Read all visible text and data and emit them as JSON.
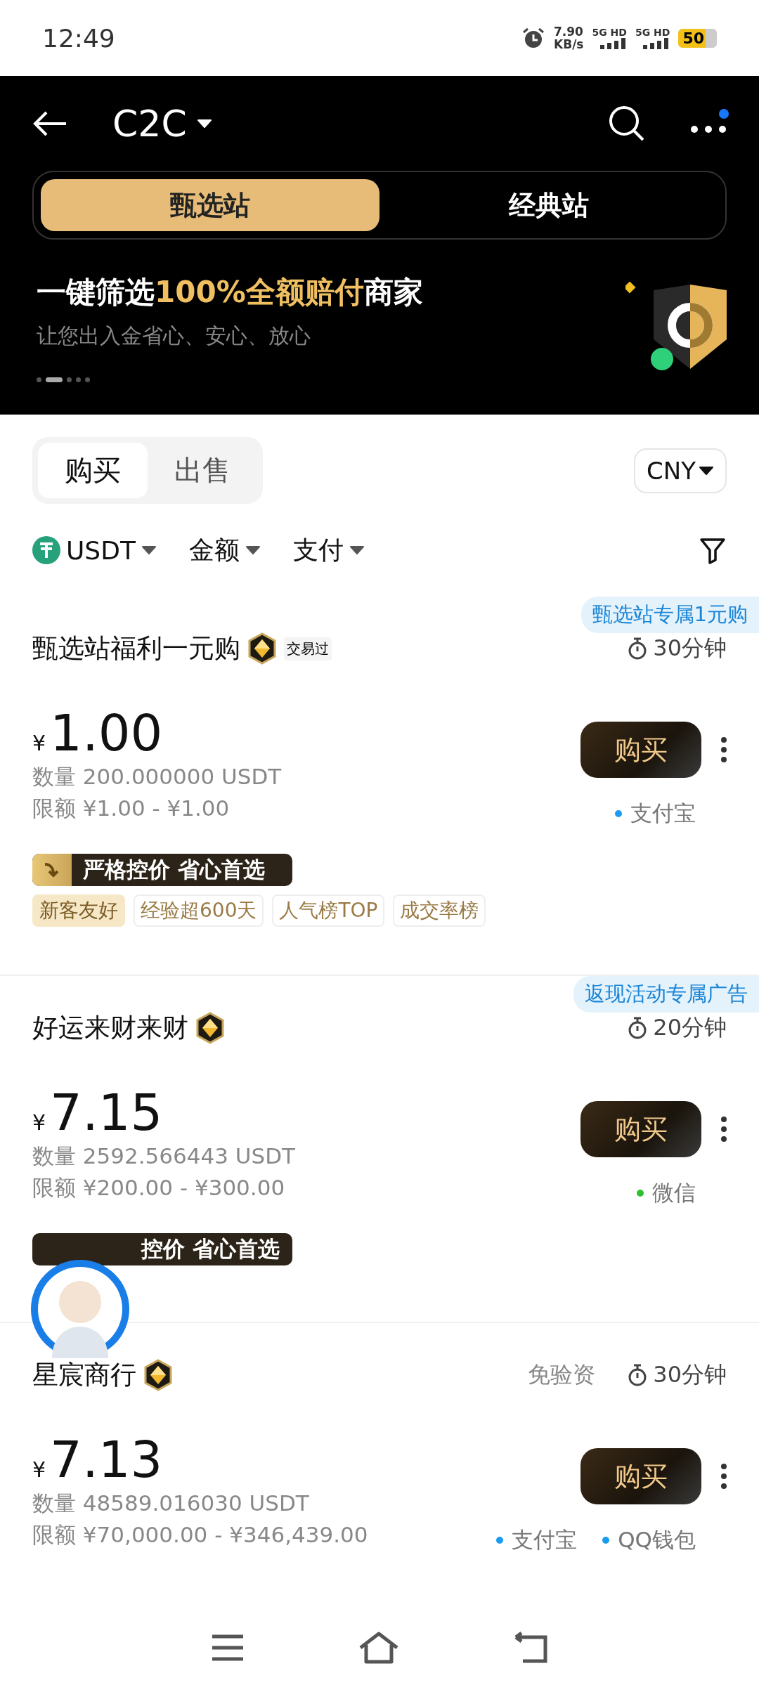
{
  "status_bar": {
    "time": "12:49",
    "speed": "7.90",
    "speed_unit": "KB/s",
    "networks": [
      "5G HD",
      "5G HD"
    ],
    "battery": "50"
  },
  "header": {
    "title": "C2C",
    "has_notification": true
  },
  "stations": [
    {
      "label": "甄选站",
      "selected": true
    },
    {
      "label": "经典站",
      "selected": false
    }
  ],
  "banner": {
    "parts": [
      {
        "text": "一键筛选",
        "highlight": false
      },
      {
        "text": "100%全额赔付",
        "highlight": true
      },
      {
        "text": "商家",
        "highlight": false
      }
    ],
    "subtitle": "让您出入金省心、安心、放心",
    "pages": [
      {
        "selected": false
      },
      {
        "selected": true
      },
      {
        "selected": false
      },
      {
        "selected": false
      },
      {
        "selected": false
      }
    ]
  },
  "trade_tabs": [
    {
      "label": "购买",
      "selected": true
    },
    {
      "label": "出售",
      "selected": false
    }
  ],
  "currency": "CNY",
  "filters": [
    {
      "label": "USDT",
      "kind": "coin"
    },
    {
      "label": "金额",
      "kind": "plain"
    },
    {
      "label": "支付",
      "kind": "plain"
    }
  ],
  "ads": [
    {
      "corner_tag": "甄选站专属1元购",
      "name": "甄选站福利一元购",
      "traded_tag": "交易过",
      "time": "30分钟",
      "currency_sign": "¥",
      "price": "1.00",
      "quantity": "数量 200.000000 USDT",
      "limit": "限额 ¥1.00 - ¥1.00",
      "button": "购买",
      "payments": [
        {
          "name": "支付宝",
          "color": "#1a9cf0"
        }
      ],
      "promo": {
        "text": "严格控价 省心首选",
        "covered": false
      },
      "tags": [
        {
          "label": "新客友好",
          "kind": "filled"
        },
        {
          "label": "经验超600天",
          "kind": "outline"
        },
        {
          "label": "人气榜TOP",
          "kind": "outline"
        },
        {
          "label": "成交率榜",
          "kind": "outline"
        }
      ]
    },
    {
      "corner_tag": "返现活动专属广告",
      "name": "好运来财来财",
      "time": "20分钟",
      "currency_sign": "¥",
      "price": "7.15",
      "quantity": "数量 2592.566443 USDT",
      "limit": "限额 ¥200.00 - ¥300.00",
      "button": "购买",
      "payments": [
        {
          "name": "微信",
          "color": "#2fc02f"
        }
      ],
      "promo": {
        "text": "控价 省心首选",
        "covered": true
      }
    },
    {
      "name": "星宸商行",
      "note": "免验资",
      "time": "30分钟",
      "currency_sign": "¥",
      "price": "7.13",
      "quantity": "数量 48589.016030 USDT",
      "limit": "限额 ¥70,000.00 - ¥346,439.00",
      "button": "购买",
      "payments": [
        {
          "name": "支付宝",
          "color": "#1a9cf0"
        },
        {
          "name": "QQ钱包",
          "color": "#1a9cf0"
        }
      ]
    }
  ]
}
